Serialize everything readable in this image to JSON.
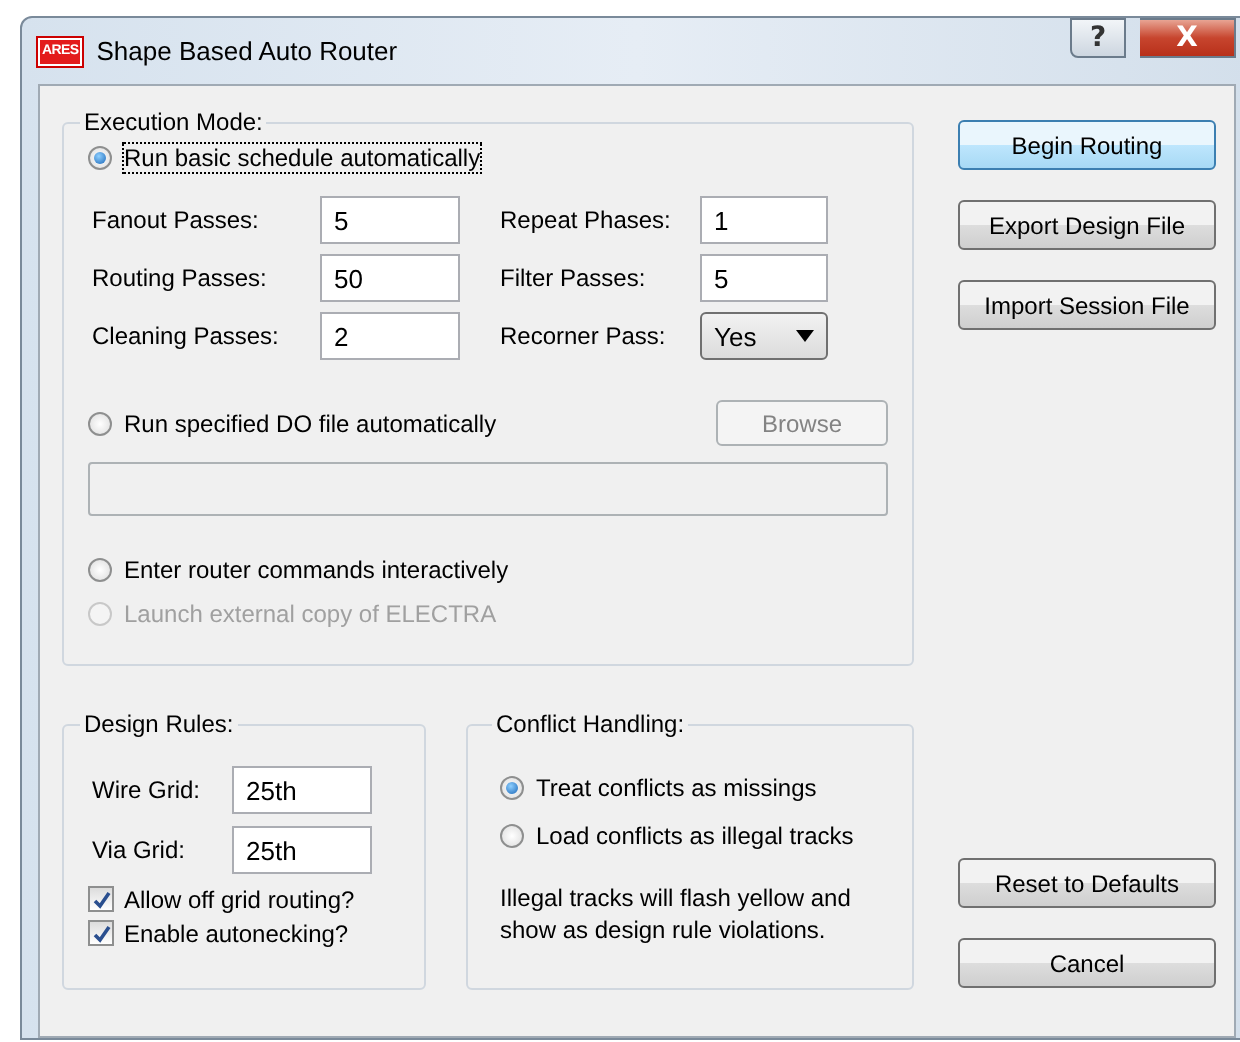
{
  "window": {
    "logo": "ARES",
    "title": "Shape Based Auto Router",
    "help": "?",
    "close": "X"
  },
  "execution_mode": {
    "title": "Execution Mode:",
    "modes": [
      {
        "label": "Run basic schedule automatically",
        "selected": true,
        "disabled": false,
        "focused": true
      },
      {
        "label": "Run specified DO file automatically",
        "selected": false,
        "disabled": false,
        "focused": false
      },
      {
        "label": "Enter router commands interactively",
        "selected": false,
        "disabled": false,
        "focused": false
      },
      {
        "label": "Launch external copy of ELECTRA",
        "selected": false,
        "disabled": true,
        "focused": false
      }
    ],
    "passes": [
      {
        "label": "Fanout Passes:",
        "value": "5",
        "kind": "field"
      },
      {
        "label": "Repeat Phases:",
        "value": "1",
        "kind": "field"
      },
      {
        "label": "Routing Passes:",
        "value": "50",
        "kind": "field"
      },
      {
        "label": "Filter Passes:",
        "value": "5",
        "kind": "field"
      },
      {
        "label": "Cleaning Passes:",
        "value": "2",
        "kind": "field"
      },
      {
        "label": "Recorner Pass:",
        "value": "Yes",
        "kind": "dropdown"
      }
    ],
    "browse_button": {
      "label": "Browse",
      "disabled": true
    },
    "do_file_field": {
      "disabled": true
    }
  },
  "design_rules": {
    "title": "Design Rules:",
    "grids": [
      {
        "label": "Wire Grid:",
        "value": "25th"
      },
      {
        "label": "Via Grid:",
        "value": "25th"
      }
    ],
    "checkboxes": [
      {
        "label": "Allow off grid routing?",
        "checked": true
      },
      {
        "label": "Enable autonecking?",
        "checked": true
      }
    ]
  },
  "conflict_handling": {
    "title": "Conflict Handling:",
    "options": [
      {
        "label": "Treat conflicts as missings",
        "selected": true
      },
      {
        "label": "Load conflicts as illegal tracks",
        "selected": false
      }
    ],
    "note": "Illegal tracks will flash yellow and show as design rule violations."
  },
  "buttons": [
    {
      "label": "Begin Routing",
      "default": true
    },
    {
      "label": "Export Design File",
      "default": false
    },
    {
      "label": "Import Session File",
      "default": false
    }
  ],
  "footer_buttons": [
    {
      "label": "Reset to Defaults",
      "default": false
    },
    {
      "label": "Cancel",
      "default": false
    }
  ]
}
